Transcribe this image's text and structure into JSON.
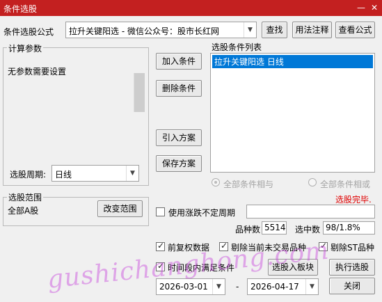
{
  "window": {
    "title": "条件选股"
  },
  "formula": {
    "label": "条件选股公式",
    "value": "拉升关键阳选 - 微信公众号：股市长红网",
    "find_btn": "查找",
    "usage_btn": "用法注释",
    "view_btn": "查看公式"
  },
  "params": {
    "group_label": "计算参数",
    "text": "无参数需要设置",
    "period_label": "选股周期:",
    "period_value": "日线"
  },
  "buttons": {
    "add": "加入条件",
    "delete": "删除条件",
    "import": "引入方案",
    "save": "保存方案"
  },
  "condition_list": {
    "label": "选股条件列表",
    "items": [
      "拉升关键阳选  日线"
    ]
  },
  "logic": {
    "and_label": "全部条件相与",
    "or_label": "全部条件相或"
  },
  "status": {
    "done": "选股完毕.",
    "done_color": "#e00000"
  },
  "range": {
    "group_label": "选股范围",
    "value": "全部A股",
    "change_btn": "改变范围"
  },
  "options": {
    "uncertain_period": "使用涨跌不定周期",
    "count_label": "品种数",
    "count_value": "5514",
    "selected_label": "选中数",
    "selected_value": "98/1.8%",
    "pre_adjust": "前复权数据",
    "exclude_untraded": "剔除当前未交易品种",
    "exclude_st": "剔除ST品种",
    "period_cond": "时间段内满足条件"
  },
  "actions": {
    "to_block": "选股入板块",
    "execute": "执行选股",
    "close": "关闭"
  },
  "dates": {
    "start": "2026-03-01",
    "separator": "-",
    "end": "2026-04-17"
  },
  "watermark": "gushichanghong.com",
  "colors": {
    "title_bar": "#c32020",
    "selection": "#0078d7"
  }
}
